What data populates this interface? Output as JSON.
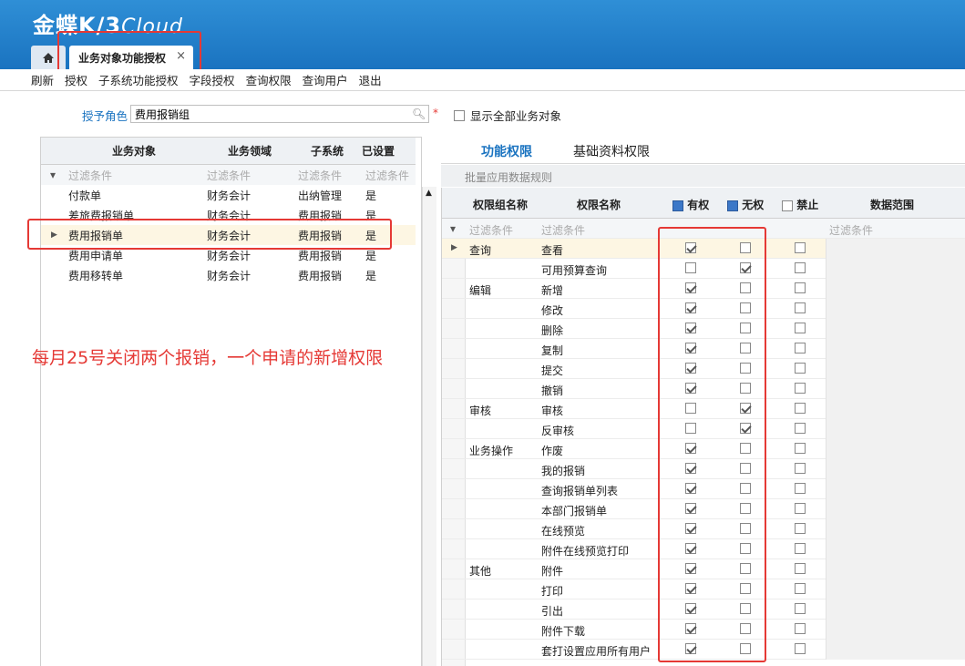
{
  "app": {
    "logo_main": "金蝶K/3",
    "logo_cloud": "Cloud"
  },
  "tabs": {
    "page_tab": "业务对象功能授权",
    "close": "×"
  },
  "menu": [
    "刷新",
    "授权",
    "子系统功能授权",
    "字段授权",
    "查询权限",
    "查询用户",
    "退出"
  ],
  "role": {
    "label": "授予角色",
    "value": "费用报销组",
    "required": "*",
    "show_all_label": "显示全部业务对象"
  },
  "left_grid": {
    "headers": [
      "业务对象",
      "业务领域",
      "子系统",
      "已设置"
    ],
    "filter": "过滤条件",
    "rows": [
      [
        "付款单",
        "财务会计",
        "出纳管理",
        "是"
      ],
      [
        "差旅费报销单",
        "财务会计",
        "费用报销",
        "是"
      ],
      [
        "费用报销单",
        "财务会计",
        "费用报销",
        "是"
      ],
      [
        "费用申请单",
        "财务会计",
        "费用报销",
        "是"
      ],
      [
        "费用移转单",
        "财务会计",
        "费用报销",
        "是"
      ]
    ]
  },
  "annotation": "每月25号关闭两个报销，一个申请的新增权限",
  "right_tabs": [
    "功能权限",
    "基础资料权限"
  ],
  "batch_label": "批量应用数据规则",
  "right_grid": {
    "headers": {
      "group": "权限组名称",
      "name": "权限名称",
      "yes": "有权",
      "no": "无权",
      "forbid": "禁止",
      "scope": "数据范围"
    },
    "filter": "过滤条件",
    "rows": [
      {
        "group": "查询",
        "name": "查看",
        "yes": true,
        "no": false,
        "forbid": false
      },
      {
        "group": "",
        "name": "可用预算查询",
        "yes": false,
        "no": true,
        "forbid": false
      },
      {
        "group": "编辑",
        "name": "新增",
        "yes": true,
        "no": false,
        "forbid": false
      },
      {
        "group": "",
        "name": "修改",
        "yes": true,
        "no": false,
        "forbid": false
      },
      {
        "group": "",
        "name": "删除",
        "yes": true,
        "no": false,
        "forbid": false
      },
      {
        "group": "",
        "name": "复制",
        "yes": true,
        "no": false,
        "forbid": false
      },
      {
        "group": "",
        "name": "提交",
        "yes": true,
        "no": false,
        "forbid": false
      },
      {
        "group": "",
        "name": "撤销",
        "yes": true,
        "no": false,
        "forbid": false
      },
      {
        "group": "审核",
        "name": "审核",
        "yes": false,
        "no": true,
        "forbid": false
      },
      {
        "group": "",
        "name": "反审核",
        "yes": false,
        "no": true,
        "forbid": false
      },
      {
        "group": "业务操作",
        "name": "作废",
        "yes": true,
        "no": false,
        "forbid": false
      },
      {
        "group": "",
        "name": "我的报销",
        "yes": true,
        "no": false,
        "forbid": false
      },
      {
        "group": "",
        "name": "查询报销单列表",
        "yes": true,
        "no": false,
        "forbid": false
      },
      {
        "group": "",
        "name": "本部门报销单",
        "yes": true,
        "no": false,
        "forbid": false
      },
      {
        "group": "",
        "name": "在线预览",
        "yes": true,
        "no": false,
        "forbid": false
      },
      {
        "group": "",
        "name": "附件在线预览打印",
        "yes": true,
        "no": false,
        "forbid": false
      },
      {
        "group": "其他",
        "name": "附件",
        "yes": true,
        "no": false,
        "forbid": false
      },
      {
        "group": "",
        "name": "打印",
        "yes": true,
        "no": false,
        "forbid": false
      },
      {
        "group": "",
        "name": "引出",
        "yes": true,
        "no": false,
        "forbid": false
      },
      {
        "group": "",
        "name": "附件下载",
        "yes": true,
        "no": false,
        "forbid": false
      },
      {
        "group": "",
        "name": "套打设置应用所有用户",
        "yes": true,
        "no": false,
        "forbid": false
      }
    ]
  }
}
